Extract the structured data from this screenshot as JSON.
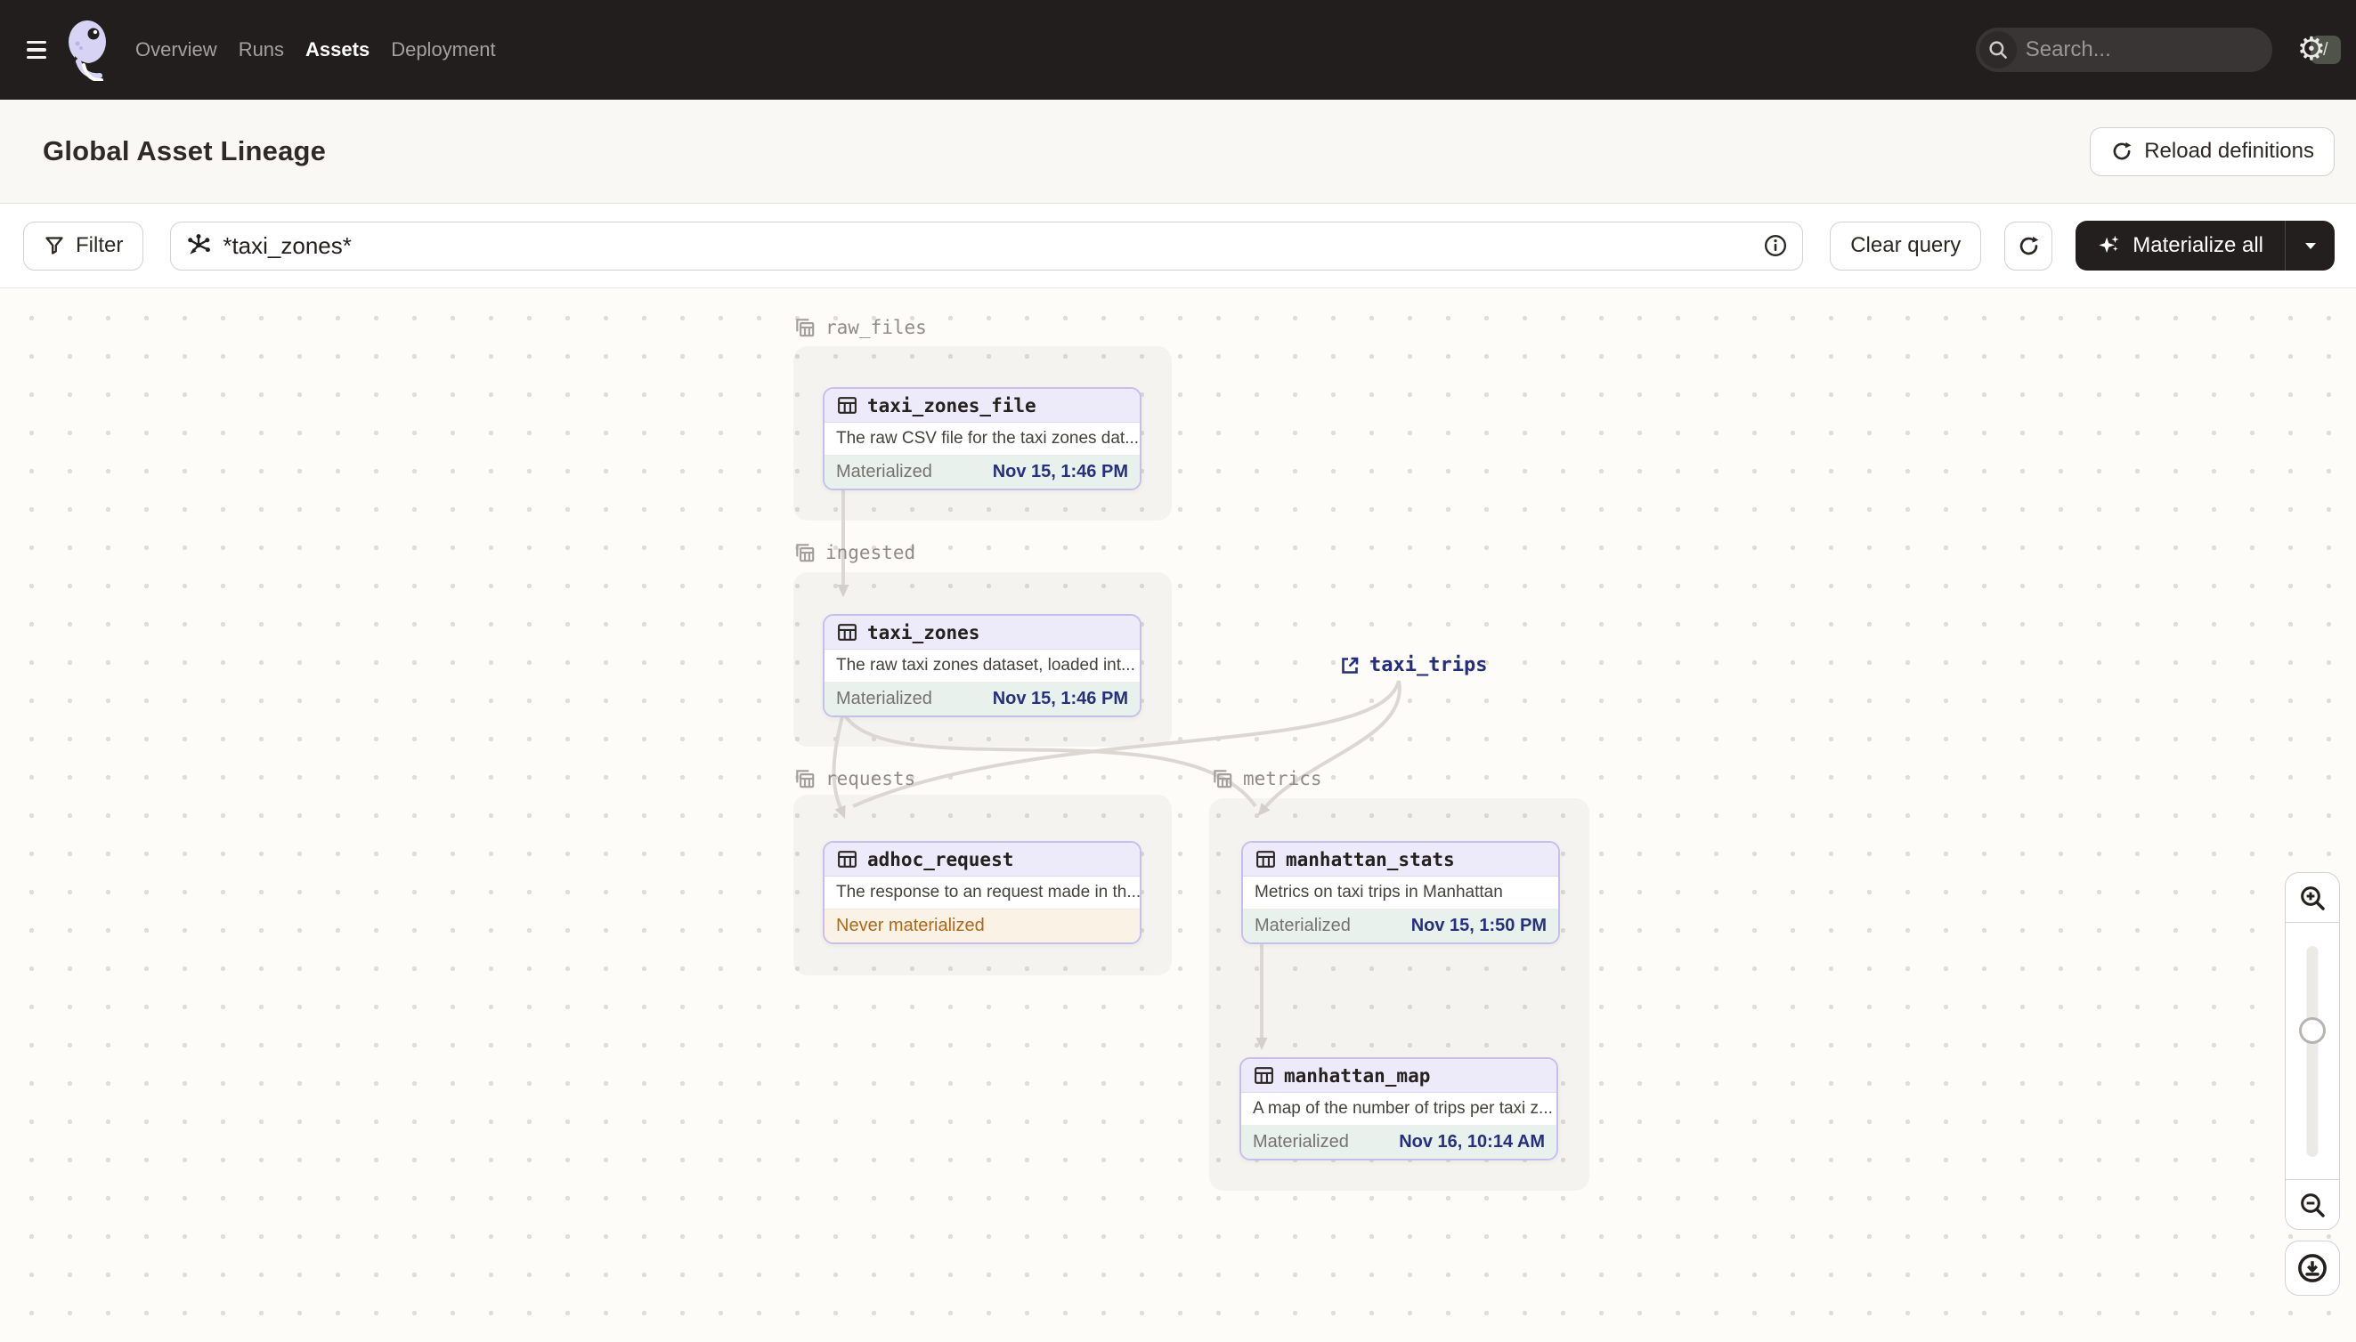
{
  "navbar": {
    "items": [
      {
        "label": "Overview",
        "active": false
      },
      {
        "label": "Runs",
        "active": false
      },
      {
        "label": "Assets",
        "active": true
      },
      {
        "label": "Deployment",
        "active": false
      }
    ],
    "search": {
      "placeholder": "Search...",
      "shortcut": "/"
    }
  },
  "page_header": {
    "title": "Global Asset Lineage",
    "reload_button": "Reload definitions"
  },
  "toolbar": {
    "filter_button": "Filter",
    "query_input": {
      "value": "*taxi_zones*"
    },
    "clear_button": "Clear query",
    "materialize_button": "Materialize all"
  },
  "graph": {
    "groups": [
      {
        "name": "raw_files"
      },
      {
        "name": "ingested"
      },
      {
        "name": "requests"
      },
      {
        "name": "metrics"
      }
    ],
    "nodes": [
      {
        "name": "taxi_zones_file",
        "group": "raw_files",
        "description": "The raw CSV file for the taxi zones dat...",
        "status": "Materialized",
        "timestamp": "Nov 15, 1:46 PM"
      },
      {
        "name": "taxi_zones",
        "group": "ingested",
        "description": "The raw taxi zones dataset, loaded int...",
        "status": "Materialized",
        "timestamp": "Nov 15, 1:46 PM"
      },
      {
        "name": "adhoc_request",
        "group": "requests",
        "description": "The response to an request made in th...",
        "status": "Never materialized",
        "timestamp": ""
      },
      {
        "name": "manhattan_stats",
        "group": "metrics",
        "description": "Metrics on taxi trips in Manhattan",
        "status": "Materialized",
        "timestamp": "Nov 15, 1:50 PM"
      },
      {
        "name": "manhattan_map",
        "group": "metrics",
        "description": "A map of the number of trips per taxi z...",
        "status": "Materialized",
        "timestamp": "Nov 16, 10:14 AM"
      }
    ],
    "external_assets": [
      {
        "name": "taxi_trips"
      }
    ],
    "edges": [
      {
        "from": "taxi_zones_file",
        "to": "taxi_zones"
      },
      {
        "from": "taxi_zones",
        "to": "adhoc_request"
      },
      {
        "from": "taxi_zones",
        "to": "manhattan_stats"
      },
      {
        "from": "taxi_trips",
        "to": "adhoc_request"
      },
      {
        "from": "taxi_trips",
        "to": "manhattan_stats"
      },
      {
        "from": "manhattan_stats",
        "to": "manhattan_map"
      }
    ]
  },
  "colors": {
    "navbar_bg": "#221e1d",
    "brand_lavender": "#d7d3f4",
    "node_border": "#c6bfec",
    "node_header_bg": "#edeafa",
    "materialized_bg": "#e9f1ec",
    "materialized_time": "#27307f",
    "never_materialized_bg": "#faf2e4",
    "never_materialized_text": "#b06718",
    "link_navy": "#252e7d",
    "edge_gray": "#dbd8d4",
    "dark_button_bg": "#231f1e"
  }
}
